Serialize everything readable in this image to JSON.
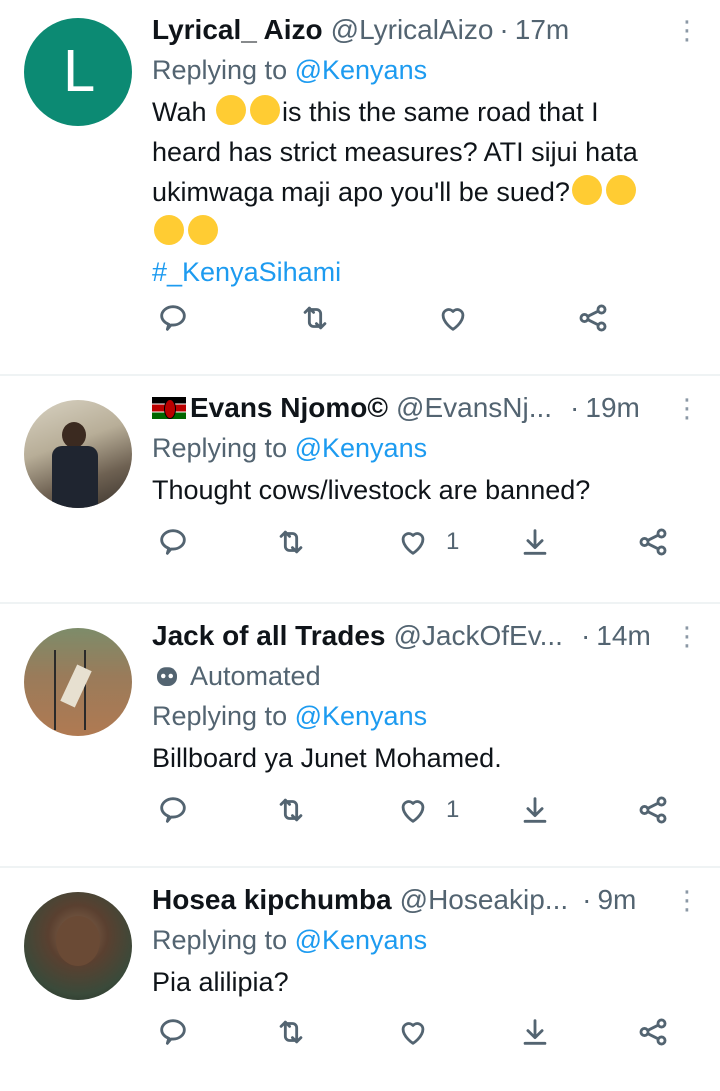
{
  "tweets": [
    {
      "avatar_letter": "L",
      "name": "Lyrical_ Aizo",
      "handle": "@LyricalAizo",
      "dot": "·",
      "time": "17m",
      "replying_prefix": "Replying to",
      "replying_to": "@Kenyans",
      "text_lines": [
        "Wah",
        "is this the same road that I",
        "heard has strict measures? ATI sijui hata",
        "ukimwaga maji apo you'll be sued?"
      ],
      "hashtag": "#_KenyaSihami",
      "like_count": ""
    },
    {
      "name": "Evans Njomo©",
      "handle": "@EvansNj...",
      "dot": "·",
      "time": "19m",
      "replying_prefix": "Replying to",
      "replying_to": "@Kenyans",
      "text": "Thought cows/livestock are banned?",
      "like_count": "1"
    },
    {
      "name": "Jack of all Trades",
      "handle": "@JackOfEv...",
      "dot": "·",
      "time": "14m",
      "automated_label": "Automated",
      "replying_prefix": "Replying to",
      "replying_to": "@Kenyans",
      "text": "Billboard ya Junet Mohamed.",
      "like_count": "1"
    },
    {
      "name": "Hosea kipchumba",
      "handle": "@Hoseakip...",
      "dot": "·",
      "time": "9m",
      "replying_prefix": "Replying to",
      "replying_to": "@Kenyans",
      "text": "Pia alilipia?",
      "like_count": ""
    }
  ],
  "colors": {
    "accent": "#1d9bf0",
    "muted": "#536471",
    "avatar_bg": "#0c8a73"
  }
}
